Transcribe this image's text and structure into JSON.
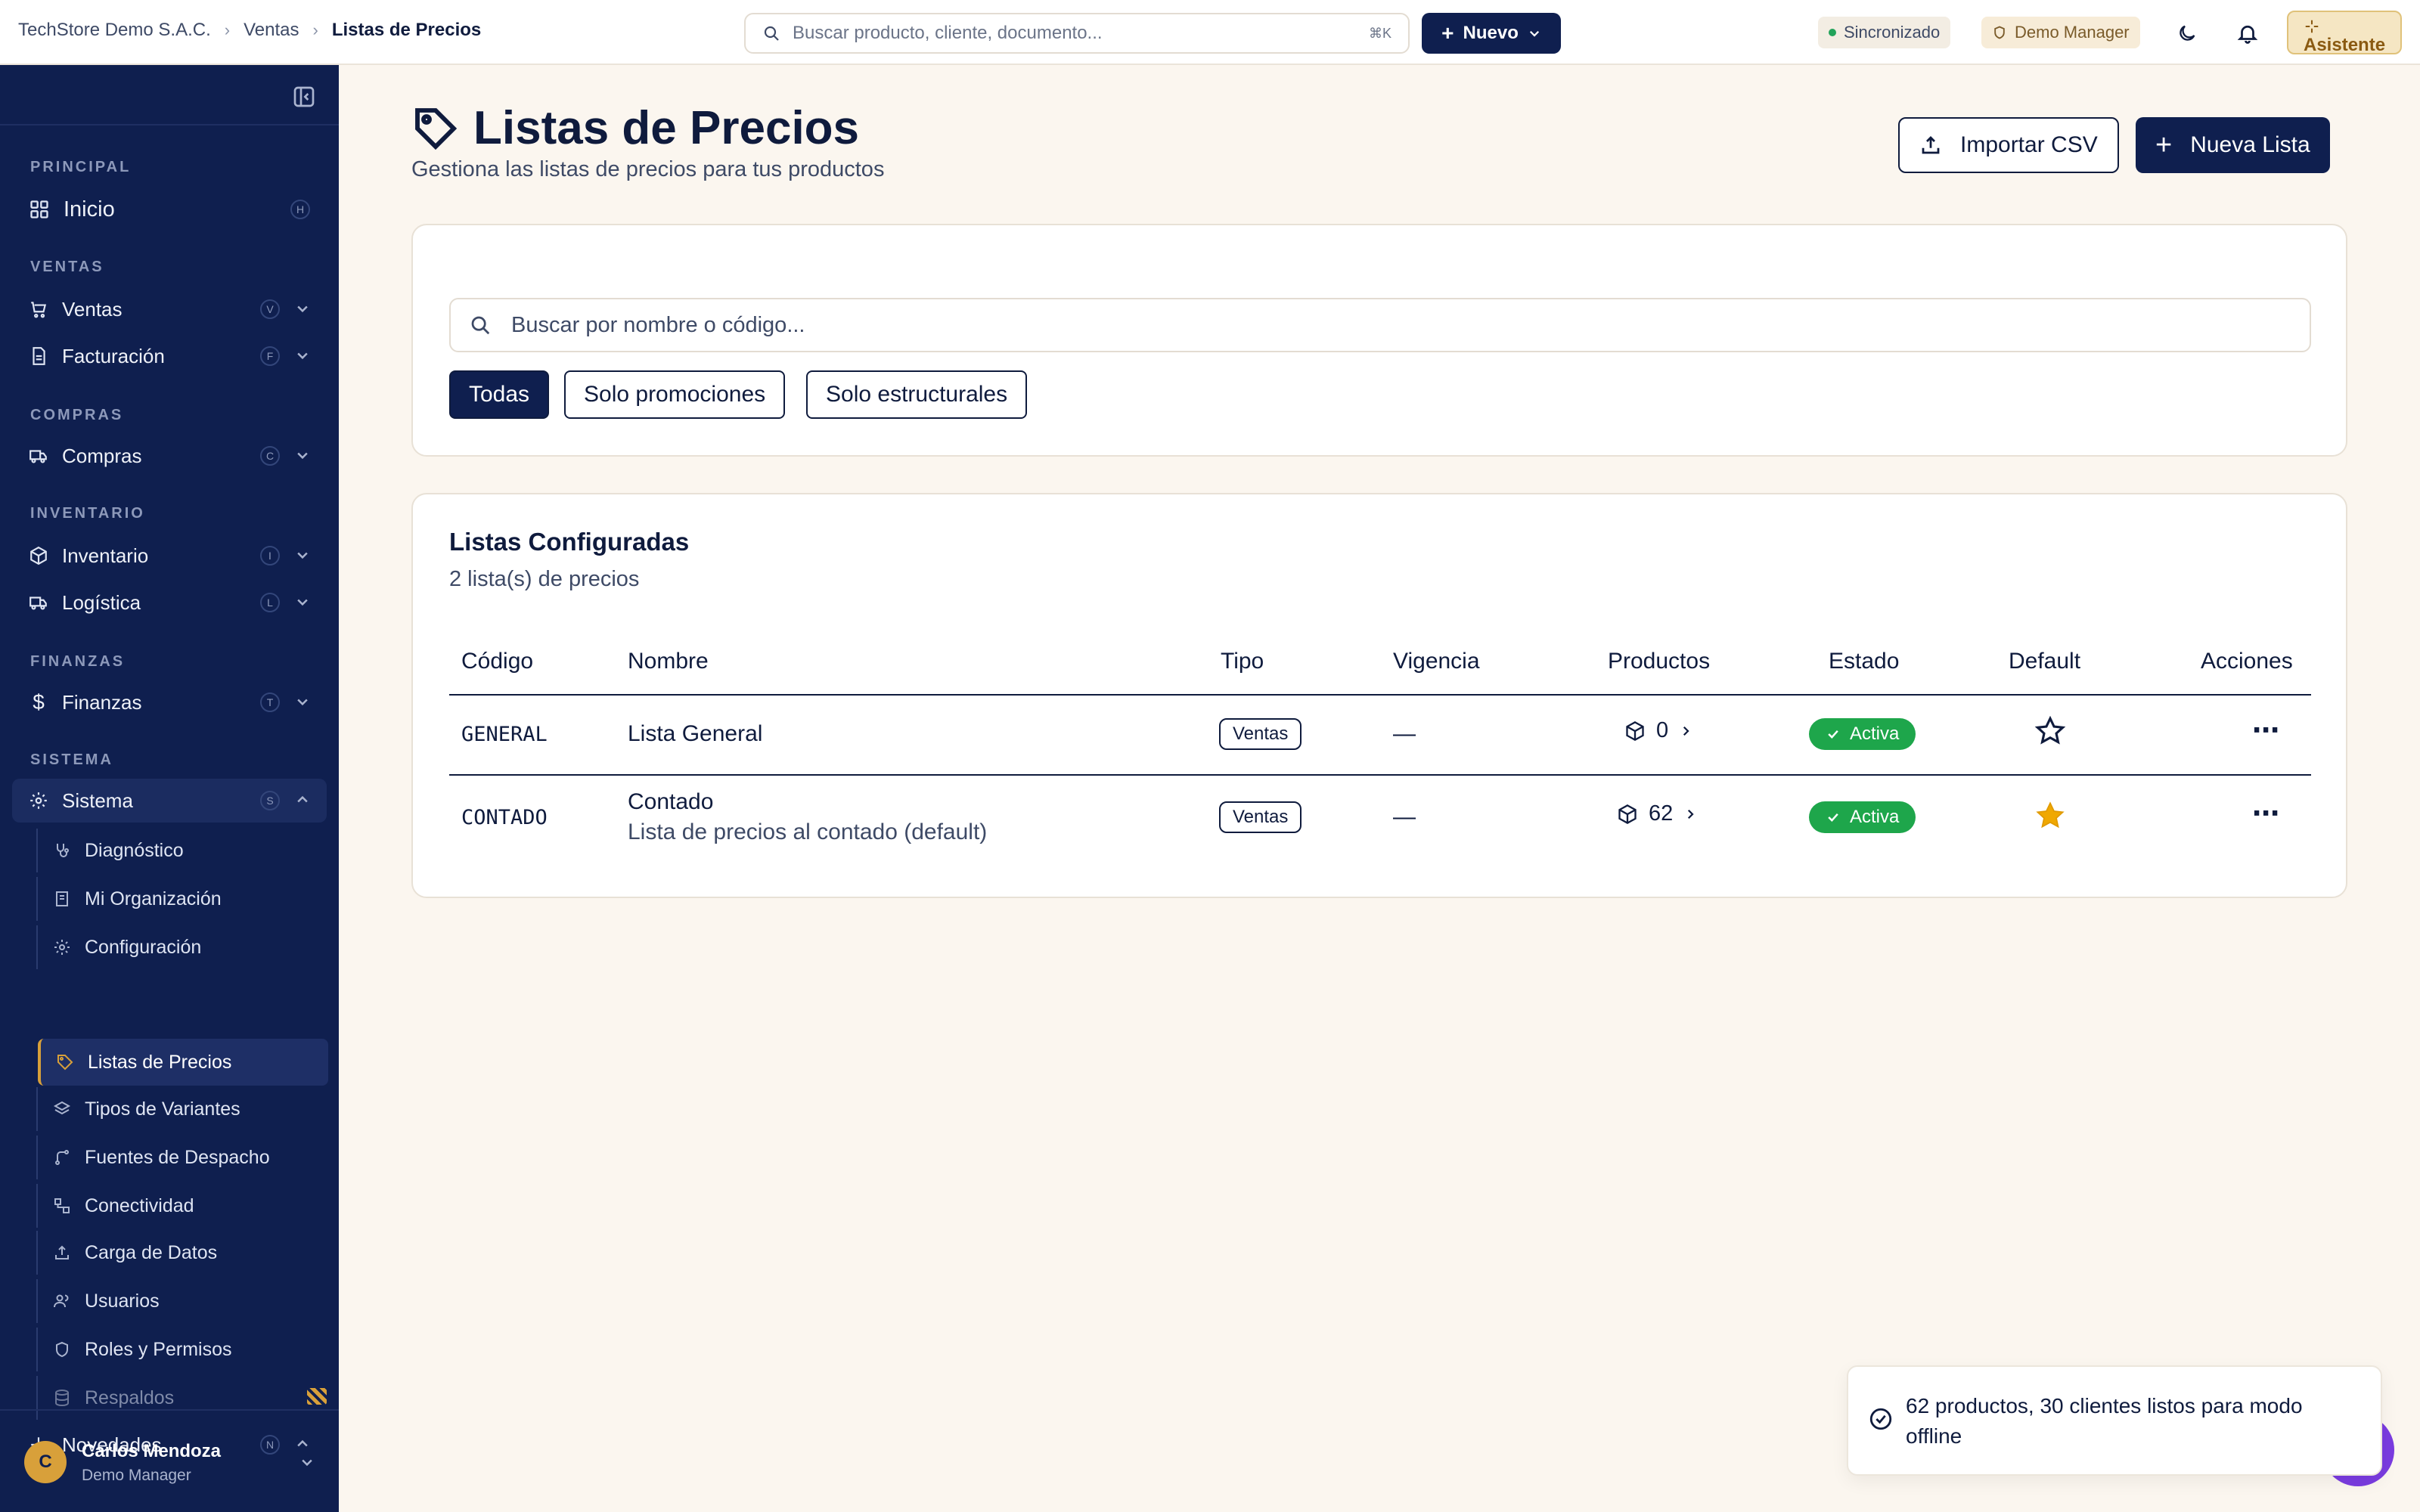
{
  "breadcrumb": [
    "TechStore Demo S.A.C.",
    "Ventas",
    "Listas de Precios"
  ],
  "global_search": {
    "placeholder": "Buscar producto, cliente, documento...",
    "shortcut": "⌘K"
  },
  "topbar": {
    "new_label": "Nuevo",
    "sync_label": "Sincronizado",
    "role_label": "Demo Manager",
    "assistant_label": "Asistente"
  },
  "sidebar": {
    "sections": {
      "principal": "PRINCIPAL",
      "ventas": "VENTAS",
      "compras": "COMPRAS",
      "inventario": "INVENTARIO",
      "finanzas": "FINANZAS",
      "sistema": "SISTEMA"
    },
    "items": [
      {
        "label": "Inicio",
        "key": "H"
      },
      {
        "label": "Ventas",
        "key": "V"
      },
      {
        "label": "Facturación",
        "key": "F"
      },
      {
        "label": "Compras",
        "key": "C"
      },
      {
        "label": "Inventario",
        "key": "I"
      },
      {
        "label": "Logística",
        "key": "L"
      },
      {
        "label": "Finanzas",
        "key": "T"
      },
      {
        "label": "Sistema",
        "key": "S"
      },
      {
        "label": "Novedades",
        "key": "N"
      }
    ],
    "sistema_sub": [
      "Diagnóstico",
      "Mi Organización",
      "Configuración",
      "Listas de Precios",
      "Tipos de Variantes",
      "Fuentes de Despacho",
      "Conectividad",
      "Carga de Datos",
      "Usuarios",
      "Roles y Permisos",
      "Respaldos"
    ],
    "user": {
      "initial": "C",
      "name": "Carlos Mendoza",
      "role": "Demo Manager"
    }
  },
  "page": {
    "title": "Listas de Precios",
    "subtitle": "Gestiona las listas de precios para tus productos",
    "import_label": "Importar CSV",
    "new_list_label": "Nueva Lista"
  },
  "filters": {
    "search_placeholder": "Buscar por nombre o código...",
    "chips": [
      "Todas",
      "Solo promociones",
      "Solo estructurales"
    ],
    "selected": "Todas"
  },
  "table": {
    "title": "Listas Configuradas",
    "count_label": "2 lista(s) de precios",
    "headers": [
      "Código",
      "Nombre",
      "Tipo",
      "Vigencia",
      "Productos",
      "Estado",
      "Default",
      "Acciones"
    ],
    "rows": [
      {
        "code": "GENERAL",
        "name": "Lista General",
        "description": "",
        "type": "Ventas",
        "validity": "—",
        "products": "0",
        "status": "Activa",
        "default": false
      },
      {
        "code": "CONTADO",
        "name": "Contado",
        "description": "Lista de precios al contado (default)",
        "type": "Ventas",
        "validity": "—",
        "products": "62",
        "status": "Activa",
        "default": true
      }
    ]
  },
  "toast": {
    "message": "62 productos, 30 clientes listos para modo offline"
  },
  "colors": {
    "navy": "#0f1f4f",
    "accent": "#d8a03a",
    "success": "#1ea64b",
    "background": "#fbf6ef"
  }
}
